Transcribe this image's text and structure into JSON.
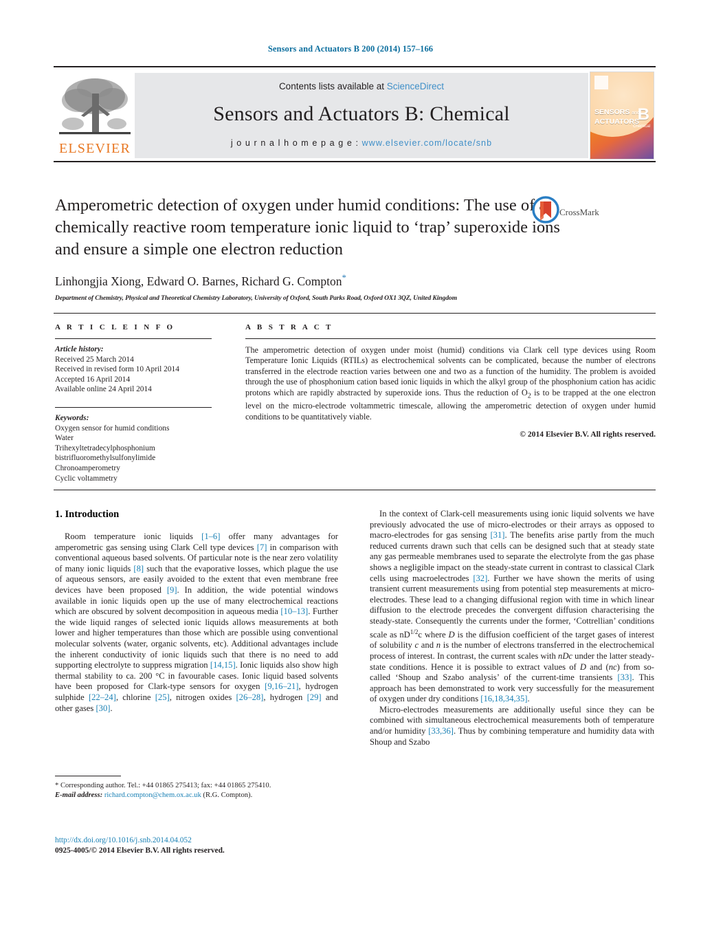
{
  "running_head": "Sensors and Actuators B 200 (2014) 157–166",
  "masthead": {
    "contents_prefix": "Contents lists available at ",
    "sciencedirect": "ScienceDirect",
    "journal_title": "Sensors and Actuators B: Chemical",
    "homepage_prefix": "j o u r n a l   h o m e p a g e :  ",
    "homepage_url": "www.elsevier.com/locate/snb",
    "publisher_wordmark": "ELSEVIER",
    "cover": {
      "line1": "SENSORS",
      "and": "and",
      "line2": "ACTUATORS",
      "letter": "B",
      "sub": "Chemical"
    },
    "accent_orange": "#E87722",
    "link_blue": "#3f8fc8",
    "band_grey": "#e6e7e9"
  },
  "article": {
    "title": "Amperometric detection of oxygen under humid conditions: The use of a chemically reactive room temperature ionic liquid to ‘trap’ superoxide ions and ensure a simple one electron reduction",
    "authors": "Linhongjia Xiong, Edward O. Barnes, Richard G. Compton",
    "corresponding_marker": "*",
    "affiliation": "Department of Chemistry, Physical and Theoretical Chemistry Laboratory, University of Oxford, South Parks Road, Oxford OX1 3QZ, United Kingdom",
    "crossmark_label": "CrossMark"
  },
  "article_info": {
    "heading": "A R T I C L E  I N F O",
    "history_label": "Article history:",
    "history": [
      "Received 25 March 2014",
      "Received in revised form 10 April 2014",
      "Accepted 16 April 2014",
      "Available online 24 April 2014"
    ],
    "keywords_label": "Keywords:",
    "keywords": [
      "Oxygen sensor for humid conditions",
      "Water",
      "Trihexyltetradecylphosphonium",
      "bistrifluoromethylsulfonylimide",
      "Chronoamperometry",
      "Cyclic voltammetry"
    ]
  },
  "abstract": {
    "heading": "A B S T R A C T",
    "text_part1": "The amperometric detection of oxygen under moist (humid) conditions via Clark cell type devices using Room Temperature Ionic Liquids (RTILs) as electrochemical solvents can be complicated, because the number of electrons transferred in the electrode reaction varies between one and two as a function of the humidity. The problem is avoided through the use of phosphonium cation based ionic liquids in which the alkyl group of the phosphonium cation has acidic protons which are rapidly abstracted by superoxide ions. Thus the reduction of O",
    "subscript": "2",
    "text_part2": " is to be trapped at the one electron level on the micro-electrode voltammetric timescale, allowing the amperometric detection of oxygen under humid conditions to be quantitatively viable.",
    "copyright": "© 2014 Elsevier B.V. All rights reserved."
  },
  "body": {
    "section_number_title": "1.  Introduction",
    "left_p1_a": "Room temperature ionic liquids ",
    "left_p1_r1": "[1–6]",
    "left_p1_b": " offer many advantages for amperometric gas sensing using Clark Cell type devices ",
    "left_p1_r2": "[7]",
    "left_p1_c": " in comparison with conventional aqueous based solvents. Of particular note is the near zero volatility of many ionic liquids ",
    "left_p1_r3": "[8]",
    "left_p1_d": " such that the evaporative losses, which plague the use of aqueous sensors, are easily avoided to the extent that even membrane free devices have been proposed ",
    "left_p1_r4": "[9]",
    "left_p1_e": ". In addition, the wide potential windows available in ionic liquids open up the use of many electrochemical reactions which are obscured by solvent decomposition in aqueous media ",
    "left_p1_r5": "[10–13]",
    "left_p1_f": ". Further the wide liquid ranges of selected ionic liquids allows measurements at both lower and higher temperatures than those which are possible using conventional molecular solvents (water, organic solvents, etc). Additional advantages include the inherent conductivity of ionic liquids such that there is no need to add supporting electrolyte to suppress migration ",
    "left_p1_r6": "[14,15]",
    "left_p1_g": ". Ionic liquids also show high thermal stability to ca. 200 °C in favourable cases. Ionic liquid based solvents have been proposed for Clark-type sensors for oxygen ",
    "left_p1_r7": "[9,16–21]",
    "left_p1_h": ", hydrogen sulphide ",
    "left_p1_r8": "[22–24]",
    "left_p1_i": ", chlorine ",
    "left_p1_r9": "[25]",
    "left_p1_j": ", nitrogen oxides ",
    "left_p1_r10": "[26–28]",
    "left_p1_k": ", hydrogen ",
    "left_p1_r11": "[29]",
    "left_p1_l": " and other gases ",
    "left_p1_r12": "[30]",
    "left_p1_m": ".",
    "right_p1_a": "In the context of Clark-cell measurements using ionic liquid solvents we have previously advocated the use of micro-electrodes or their arrays as opposed to macro-electrodes for gas sensing ",
    "right_p1_r1": "[31]",
    "right_p1_b": ". The benefits arise partly from the much reduced currents drawn such that cells can be designed such that at steady state any gas permeable membranes used to separate the electrolyte from the gas phase shows a negligible impact on the steady-state current in contrast to classical Clark cells using macroelectrodes ",
    "right_p1_r2": "[32]",
    "right_p1_c": ". Further we have shown the merits of using transient current measurements using from potential step measurements at micro-electrodes. These lead to a changing diffusional region with time in which linear diffusion to the electrode precedes the convergent diffusion characterising the steady-state. Consequently the currents under the former, ‘Cottrellian’ conditions scale as nD",
    "right_p1_sup": "1/2",
    "right_p1_d": "c where ",
    "right_p1_italD": "D",
    "right_p1_e": " is the diffusion coefficient of the target gases of interest of solubility ",
    "right_p1_italc": "c",
    "right_p1_f": " and ",
    "right_p1_italn": "n",
    "right_p1_g": " is the number of electrons transferred in the electrochemical process of interest. In contrast, the current scales with ",
    "right_p1_italnDc": "nDc",
    "right_p1_h": " under the latter steady-state conditions. Hence it is possible to extract values of ",
    "right_p1_italD2": "D",
    "right_p1_i": " and (",
    "right_p1_italnc": "nc",
    "right_p1_j": ") from so-called ‘Shoup and Szabo analysis’ of the current-time transients ",
    "right_p1_r3": "[33]",
    "right_p1_k": ". This approach has been demonstrated to work very successfully for the measurement of oxygen under dry conditions ",
    "right_p1_r4": "[16,18,34,35]",
    "right_p1_l": ".",
    "right_p2_a": "Micro-electrodes measurements are additionally useful since they can be combined with simultaneous electrochemical measurements both of temperature and/or humidity ",
    "right_p2_r1": "[33,36]",
    "right_p2_b": ". Thus by combining temperature and humidity data with Shoup and Szabo"
  },
  "footnote": {
    "marker": "*",
    "text_a": " Corresponding author. Tel.: +44 01865 275413; fax: +44 01865 275410.",
    "email_label": "E-mail address:",
    "email": "richard.compton@chem.ox.ac.uk",
    "email_suffix": " (R.G. Compton)."
  },
  "footer": {
    "doi": "http://dx.doi.org/10.1016/j.snb.2014.04.052",
    "issn_line": "0925-4005/© 2014 Elsevier B.V. All rights reserved."
  }
}
